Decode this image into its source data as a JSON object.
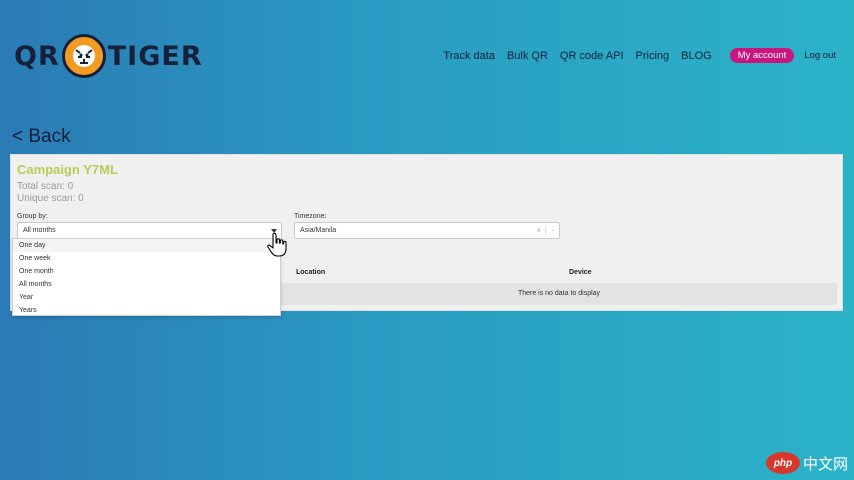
{
  "header": {
    "logo_left": "QR",
    "logo_right": "TIGER",
    "nav": [
      {
        "label": "Track data"
      },
      {
        "label": "Bulk QR"
      },
      {
        "label": "QR code API"
      },
      {
        "label": "Pricing"
      },
      {
        "label": "BLOG"
      }
    ],
    "account_label": "My account",
    "logout_label": "Log out",
    "colors": {
      "brand_dark": "#15213a",
      "logo_orange": "#f29b22",
      "account_pink": "#c8157f"
    }
  },
  "back_label": "< Back",
  "campaign": {
    "title": "Campaign Y7ML",
    "total_scan_label": "Total scan:",
    "total_scan_value": "0",
    "unique_scan_label": "Unique scan:",
    "unique_scan_value": "0",
    "title_color": "#b7cc5a"
  },
  "group_by": {
    "label": "Group by:",
    "selected": "All months",
    "options": [
      "One day",
      "One week",
      "One month",
      "All months",
      "Year",
      "Years"
    ],
    "icon": "caret-down-icon"
  },
  "timezone": {
    "label": "Timezone:",
    "selected": "Asia/Manila",
    "clear_glyph": "×",
    "caret_glyph": "⌄"
  },
  "table": {
    "columns": [
      "Location",
      "Device"
    ],
    "empty_message": "There is no data to display"
  },
  "cursor": {
    "icon": "hand-pointer-icon"
  },
  "watermark": {
    "logo_text": "php",
    "text": "中文网"
  }
}
